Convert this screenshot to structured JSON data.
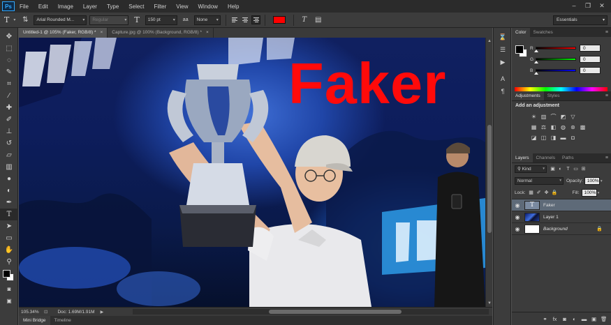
{
  "app": {
    "logo": "Ps"
  },
  "menu": [
    "File",
    "Edit",
    "Image",
    "Layer",
    "Type",
    "Select",
    "Filter",
    "View",
    "Window",
    "Help"
  ],
  "window_controls": {
    "minimize": "–",
    "restore": "❐",
    "close": "✕"
  },
  "options_bar": {
    "tool_icon": "T",
    "font_family": "Arial Rounded M...",
    "font_style": "Regular",
    "size_icon": "T",
    "font_size": "150 pt",
    "aa_icon": "aa",
    "antialias": "None",
    "text_color": "#ff0000",
    "workspace": "Essentials"
  },
  "tabs": [
    {
      "label": "Untitled-1 @ 105% (Faker, RGB/8) *",
      "close": "×"
    },
    {
      "label": "Capture.jpg @ 100% (Background, RGB/8) *",
      "close": "×"
    }
  ],
  "canvas": {
    "text_layer_content": "Faker"
  },
  "status": {
    "zoom": "105.34%",
    "doc": "Doc: 1.69M/1.91M"
  },
  "bottom_tabs": [
    "Mini Bridge",
    "Timeline"
  ],
  "color_panel": {
    "tabs": [
      "Color",
      "Swatches"
    ],
    "foreground": "#000000",
    "background": "#ffffff",
    "sliders": [
      {
        "label": "R",
        "value": "0",
        "gradient": "linear-gradient(90deg,#000,#ff0000)"
      },
      {
        "label": "G",
        "value": "0",
        "gradient": "linear-gradient(90deg,#000,#00ff00)"
      },
      {
        "label": "B",
        "value": "0",
        "gradient": "linear-gradient(90deg,#000,#0000ff)"
      }
    ]
  },
  "adjustments_panel": {
    "tabs": [
      "Adjustments",
      "Styles"
    ],
    "title": "Add an adjustment"
  },
  "layers_panel": {
    "tabs": [
      "Layers",
      "Channels",
      "Paths"
    ],
    "filter_kind": "Kind",
    "blend_mode": "Normal",
    "opacity_label": "Opacity:",
    "opacity": "100%",
    "lock_label": "Lock:",
    "fill_label": "Fill:",
    "fill": "100%",
    "layers": [
      {
        "name": "Faker",
        "type": "text",
        "selected": true
      },
      {
        "name": "Layer 1",
        "type": "image",
        "selected": false
      },
      {
        "name": "Background",
        "type": "background",
        "selected": false
      }
    ]
  },
  "icons": {
    "tools": [
      "move-icon",
      "marquee-icon",
      "lasso-icon",
      "quick-select-icon",
      "crop-icon",
      "eyedropper-icon",
      "healing-brush-icon",
      "brush-icon",
      "clone-stamp-icon",
      "history-brush-icon",
      "eraser-icon",
      "gradient-icon",
      "blur-icon",
      "dodge-icon",
      "pen-icon",
      "type-icon",
      "path-select-icon",
      "shape-icon",
      "hand-icon",
      "zoom-icon"
    ]
  }
}
